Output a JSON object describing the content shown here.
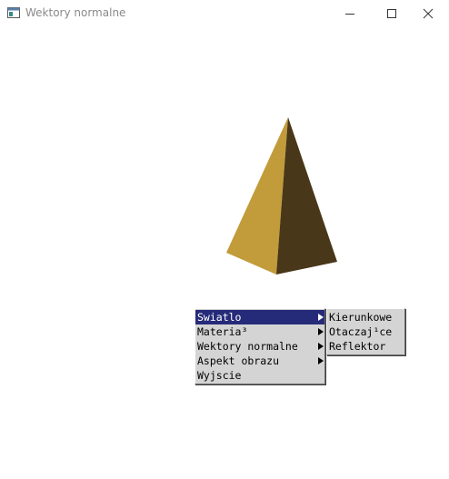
{
  "window": {
    "title": "Wektory normalne",
    "icon": "app-window-icon",
    "controls": {
      "minimize_icon": "minimize-icon",
      "maximize_icon": "maximize-icon",
      "close_icon": "close-icon"
    }
  },
  "scene": {
    "object": "pyramid",
    "colors": {
      "lit_face": "#c29b3a",
      "shadow_face": "#483718"
    }
  },
  "context_menu": {
    "items": [
      {
        "label": "Swiatlo",
        "has_submenu": true,
        "highlighted": true
      },
      {
        "label": "Materia³",
        "has_submenu": true,
        "highlighted": false
      },
      {
        "label": "Wektory normalne",
        "has_submenu": true,
        "highlighted": false
      },
      {
        "label": "Aspekt obrazu",
        "has_submenu": true,
        "highlighted": false
      },
      {
        "label": "Wyjscie",
        "has_submenu": false,
        "highlighted": false
      }
    ],
    "highlight_color": "#262b79",
    "submenu": {
      "items": [
        {
          "label": "Kierunkowe"
        },
        {
          "label": "Otaczaj¹ce"
        },
        {
          "label": "Reflektor"
        }
      ]
    }
  }
}
